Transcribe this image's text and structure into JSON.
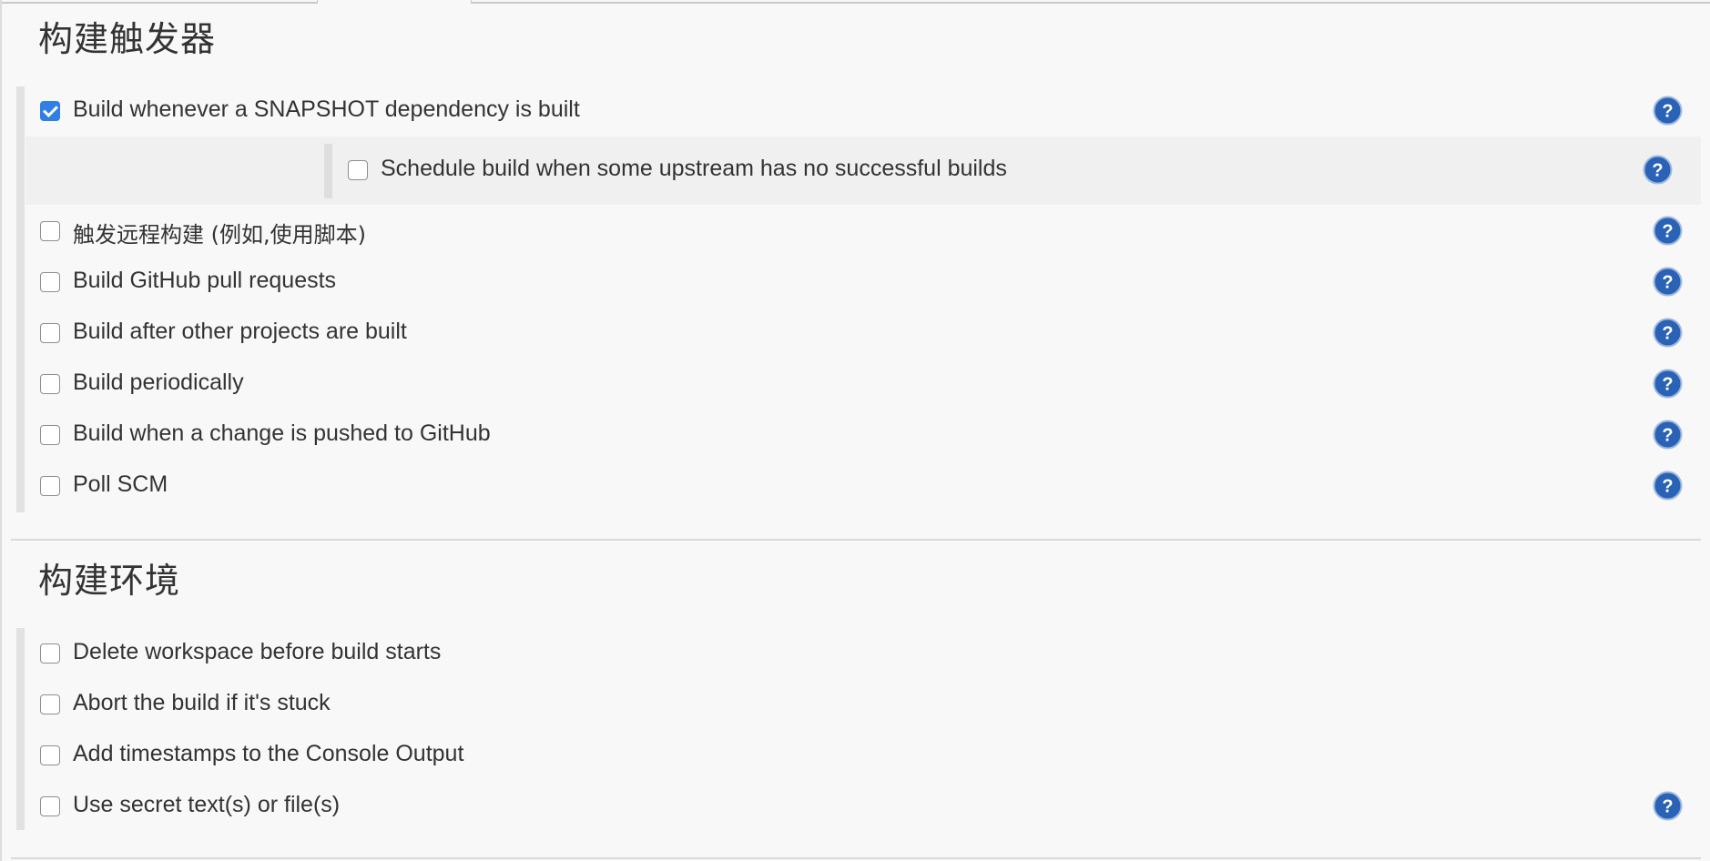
{
  "sections": {
    "triggers": {
      "title": "构建触发器",
      "items": [
        {
          "label": "Build whenever a SNAPSHOT dependency is built",
          "checked": true,
          "help": true,
          "sub": {
            "label": "Schedule build when some upstream has no successful builds",
            "checked": false,
            "help": true
          }
        },
        {
          "label": "触发远程构建 (例如,使用脚本)",
          "checked": false,
          "help": true
        },
        {
          "label": "Build GitHub pull requests",
          "checked": false,
          "help": true
        },
        {
          "label": "Build after other projects are built",
          "checked": false,
          "help": true
        },
        {
          "label": "Build periodically",
          "checked": false,
          "help": true
        },
        {
          "label": "Build when a change is pushed to GitHub",
          "checked": false,
          "help": true
        },
        {
          "label": "Poll SCM",
          "checked": false,
          "help": true
        }
      ]
    },
    "environment": {
      "title": "构建环境",
      "items": [
        {
          "label": "Delete workspace before build starts",
          "checked": false,
          "help": false
        },
        {
          "label": "Abort the build if it's stuck",
          "checked": false,
          "help": false
        },
        {
          "label": "Add timestamps to the Console Output",
          "checked": false,
          "help": false
        },
        {
          "label": "Use secret text(s) or file(s)",
          "checked": false,
          "help": true
        }
      ]
    }
  },
  "icons": {
    "help": "help-question-icon",
    "checkbox": "checkbox-icon"
  },
  "colors": {
    "accent": "#2f7fe6",
    "help_blue": "#2a62b5",
    "background": "#f8f8f8"
  }
}
